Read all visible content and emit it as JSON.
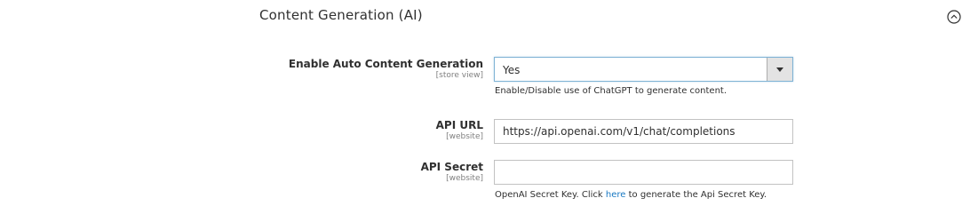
{
  "section": {
    "title": "Content Generation (AI)",
    "collapse_icon": "chevron-up-circle-icon"
  },
  "fields": {
    "enable": {
      "label": "Enable Auto Content Generation",
      "scope": "[store view]",
      "value": "Yes",
      "arrow_icon": "triangle-down-icon",
      "note": "Enable/Disable use of ChatGPT to generate content."
    },
    "api_url": {
      "label": "API URL",
      "scope": "[website]",
      "value": "https://api.openai.com/v1/chat/completions"
    },
    "api_secret": {
      "label": "API Secret",
      "scope": "[website]",
      "value": "",
      "note_before": "OpenAI Secret Key. Click ",
      "note_link": "here",
      "note_after": " to generate the Api Secret Key."
    }
  },
  "colors": {
    "link": "#1979c3",
    "label": "#303030",
    "scope": "#808080",
    "select_focus_border": "#7fb3d5",
    "arrow_bg": "#e3e3e3"
  }
}
